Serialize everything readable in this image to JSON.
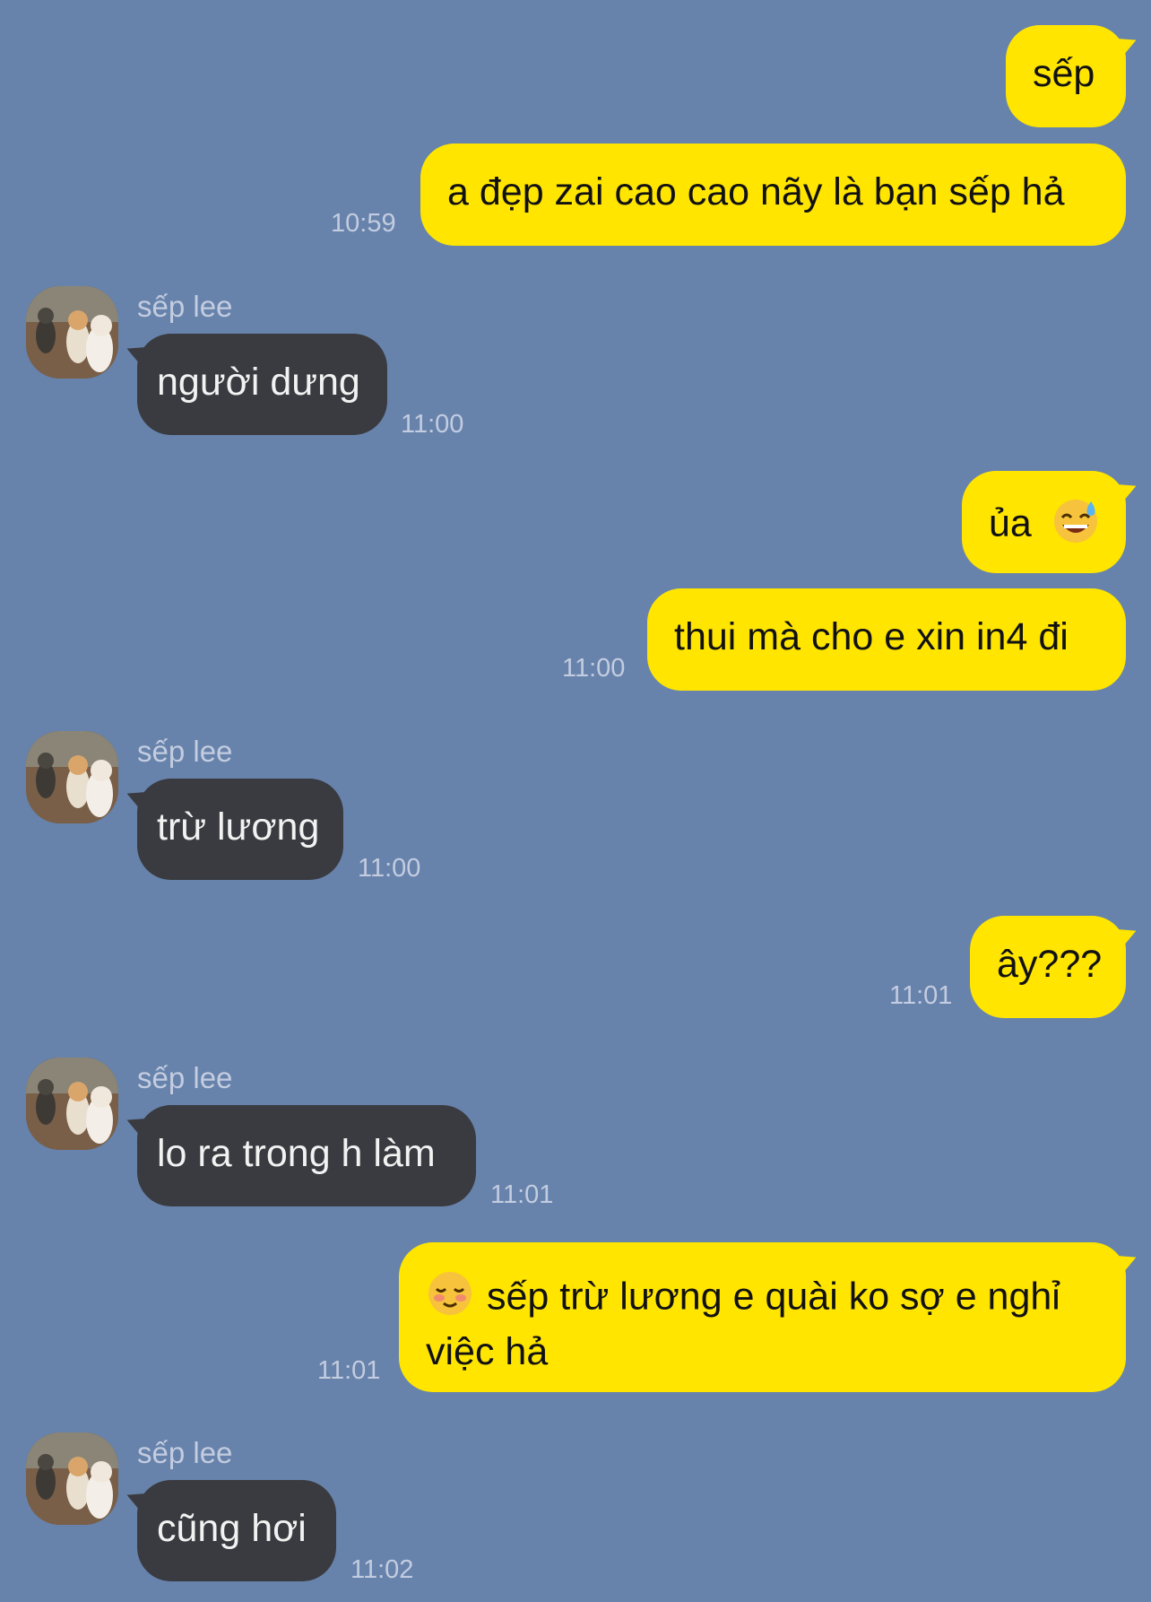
{
  "chat": {
    "messages": [
      {
        "text": "sếp"
      },
      {
        "text": "a đẹp zai cao cao nãy là bạn sếp hả",
        "time": "10:59"
      },
      {
        "sender": "sếp lee",
        "text": "người dưng",
        "time": "11:00"
      },
      {
        "text": "ủa",
        "emoji": "grinning-sweat-emoji"
      },
      {
        "text": "thui mà cho e xin in4 đi",
        "time": "11:00"
      },
      {
        "sender": "sếp lee",
        "text": "trừ lương",
        "time": "11:00"
      },
      {
        "text": "ây???",
        "time": "11:01"
      },
      {
        "sender": "sếp lee",
        "text": "lo ra trong h làm",
        "time": "11:01"
      },
      {
        "text_line1": "sếp trừ lương e quài ko sợ e nghỉ",
        "text_line2": "việc hả",
        "emoji": "smiling-blush-emoji",
        "time": "11:01"
      },
      {
        "sender": "sếp lee",
        "text": "cũng hơi",
        "time": "11:02"
      }
    ]
  },
  "colors": {
    "background": "#6783ab",
    "outgoing_bubble": "#ffe500",
    "incoming_bubble": "#3a3b40",
    "meta_text": "#c3cce0"
  }
}
